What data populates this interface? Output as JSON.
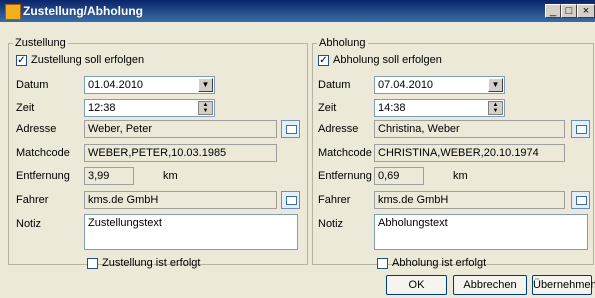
{
  "window": {
    "title": "Zustellung/Abholung"
  },
  "left": {
    "legend": "Zustellung",
    "active_checkbox": "Zustellung soll erfolgen",
    "labels": {
      "datum": "Datum",
      "zeit": "Zeit",
      "adresse": "Adresse",
      "matchcode": "Matchcode",
      "entfernung": "Entfernung",
      "fahrer": "Fahrer",
      "notiz": "Notiz"
    },
    "values": {
      "datum": "01.04.2010",
      "zeit": "12:38",
      "adresse": "Weber, Peter",
      "matchcode": "WEBER,PETER,10.03.1985",
      "entfernung": "3,99",
      "fahrer": "kms.de GmbH",
      "notiz": "Zustellungstext"
    },
    "unit": "km",
    "done_checkbox": "Zustellung ist erfolgt"
  },
  "right": {
    "legend": "Abholung",
    "active_checkbox": "Abholung soll erfolgen",
    "labels": {
      "datum": "Datum",
      "zeit": "Zeit",
      "adresse": "Adresse",
      "matchcode": "Matchcode",
      "entfernung": "Entfernung",
      "fahrer": "Fahrer",
      "notiz": "Notiz"
    },
    "values": {
      "datum": "07.04.2010",
      "zeit": "14:38",
      "adresse": "Christina, Weber",
      "matchcode": "CHRISTINA,WEBER,20.10.1974",
      "entfernung": "0,69",
      "fahrer": "kms.de GmbH",
      "notiz": "Abholungstext"
    },
    "unit": "km",
    "done_checkbox": "Abholung ist erfolgt"
  },
  "buttons": {
    "ok": "OK",
    "cancel": "Abbrechen",
    "apply": "Übernehmen"
  }
}
